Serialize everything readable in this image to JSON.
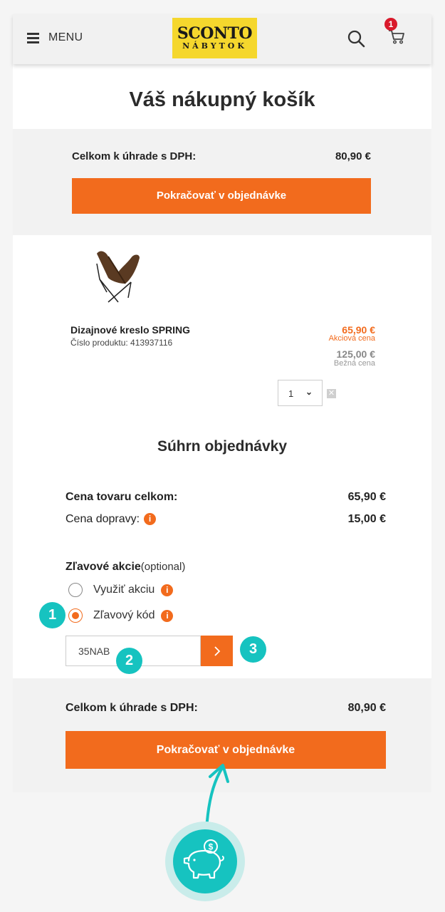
{
  "header": {
    "menu_label": "MENU",
    "logo_line1": "SCONTO",
    "logo_line2": "NÁBYTOK",
    "cart_count": "1"
  },
  "page_title": "Váš nákupný košík",
  "top_total": {
    "label": "Celkom k úhrade s DPH:",
    "value": "80,90 €",
    "button": "Pokračovať v objednávke"
  },
  "product": {
    "name": "Dizajnové kreslo SPRING",
    "number": "Číslo produktu: 413937116",
    "sale_price": "65,90 €",
    "sale_label": "Akciová cena",
    "regular_price": "125,00 €",
    "regular_label": "Bežná cena",
    "quantity": "1"
  },
  "summary": {
    "title": "Súhrn objednávky",
    "goods_label": "Cena tovaru celkom:",
    "goods_value": "65,90 €",
    "shipping_label": "Cena dopravy:",
    "shipping_value": "15,00 €"
  },
  "discount": {
    "title": "Zľavové akcie",
    "optional": "(optional)",
    "options": [
      {
        "label": "Využiť akciu",
        "selected": false
      },
      {
        "label": "Zľavový kód",
        "selected": true
      }
    ],
    "code_value": "35NAB"
  },
  "bottom_total": {
    "label": "Celkom k úhrade s DPH:",
    "value": "80,90 €",
    "button": "Pokračovať v objednávke"
  },
  "steps": [
    "1",
    "2",
    "3"
  ],
  "colors": {
    "accent": "#f26b1d",
    "teal": "#16c3c0",
    "logo_yellow": "#f5d72d",
    "badge_red": "#d9192b"
  }
}
